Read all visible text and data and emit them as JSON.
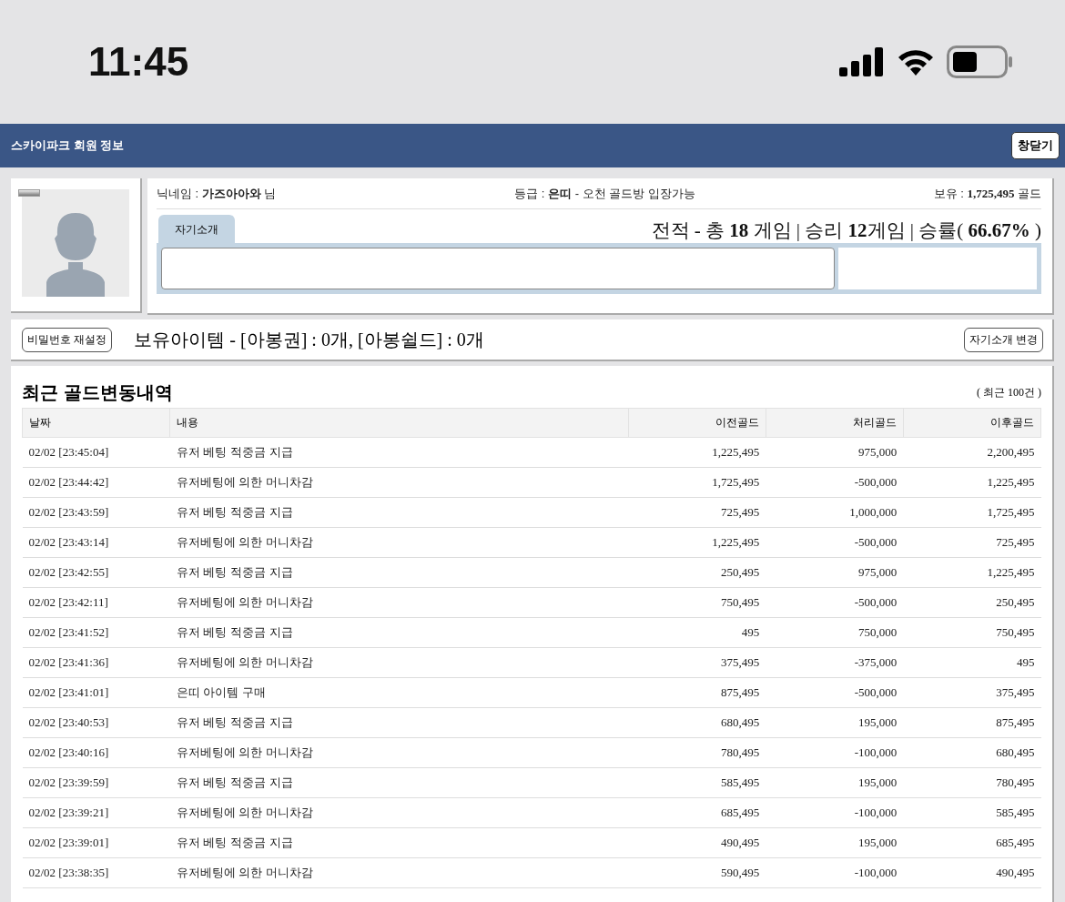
{
  "status_bar": {
    "time": "11:45"
  },
  "header": {
    "title": "스카이파크 회원 정보",
    "close_button": "창닫기"
  },
  "profile": {
    "nickname": "닉네임 : **가즈아아와** 님",
    "grade": "등급 : **은띠** - 오천 골드방 입장가능",
    "balance": "보유 : **1,725,495** 골드",
    "record": "전적 - 총 **18** 게임 | 승리 **12**게임 | 승률( **66.67%** )",
    "tabs": [
      {
        "label": "자기소개",
        "selected": true
      }
    ]
  },
  "items_bar": {
    "reset_password": "비밀번호 재설정",
    "items": "보유아이템 - [아봉권] : 0개, [아봉쉴드] : 0개",
    "change_intro": "자기소개 변경"
  },
  "history": {
    "title": "최근 골드변동내역",
    "count": "( 최근 100건 )",
    "columns": [
      "날짜",
      "내용",
      "이전골드",
      "처리골드",
      "이후골드"
    ],
    "rows": [
      [
        "02/02 [23:45:04]",
        "유저 베팅 적중금 지급",
        "1,225,495",
        "975,000",
        "2,200,495"
      ],
      [
        "02/02 [23:44:42]",
        "유저베팅에 의한 머니차감",
        "1,725,495",
        "-500,000",
        "1,225,495"
      ],
      [
        "02/02 [23:43:59]",
        "유저 베팅 적중금 지급",
        "725,495",
        "1,000,000",
        "1,725,495"
      ],
      [
        "02/02 [23:43:14]",
        "유저베팅에 의한 머니차감",
        "1,225,495",
        "-500,000",
        "725,495"
      ],
      [
        "02/02 [23:42:55]",
        "유저 베팅 적중금 지급",
        "250,495",
        "975,000",
        "1,225,495"
      ],
      [
        "02/02 [23:42:11]",
        "유저베팅에 의한 머니차감",
        "750,495",
        "-500,000",
        "250,495"
      ],
      [
        "02/02 [23:41:52]",
        "유저 베팅 적중금 지급",
        "495",
        "750,000",
        "750,495"
      ],
      [
        "02/02 [23:41:36]",
        "유저베팅에 의한 머니차감",
        "375,495",
        "-375,000",
        "495"
      ],
      [
        "02/02 [23:41:01]",
        "은띠 아이템 구매",
        "875,495",
        "-500,000",
        "375,495"
      ],
      [
        "02/02 [23:40:53]",
        "유저 베팅 적중금 지급",
        "680,495",
        "195,000",
        "875,495"
      ],
      [
        "02/02 [23:40:16]",
        "유저베팅에 의한 머니차감",
        "780,495",
        "-100,000",
        "680,495"
      ],
      [
        "02/02 [23:39:59]",
        "유저 베팅 적중금 지급",
        "585,495",
        "195,000",
        "780,495"
      ],
      [
        "02/02 [23:39:21]",
        "유저베팅에 의한 머니차감",
        "685,495",
        "-100,000",
        "585,495"
      ],
      [
        "02/02 [23:39:01]",
        "유저 베팅 적중금 지급",
        "490,495",
        "195,000",
        "685,495"
      ],
      [
        "02/02 [23:38:35]",
        "유저베팅에 의한 머니차감",
        "590,495",
        "-100,000",
        "490,495"
      ]
    ]
  }
}
